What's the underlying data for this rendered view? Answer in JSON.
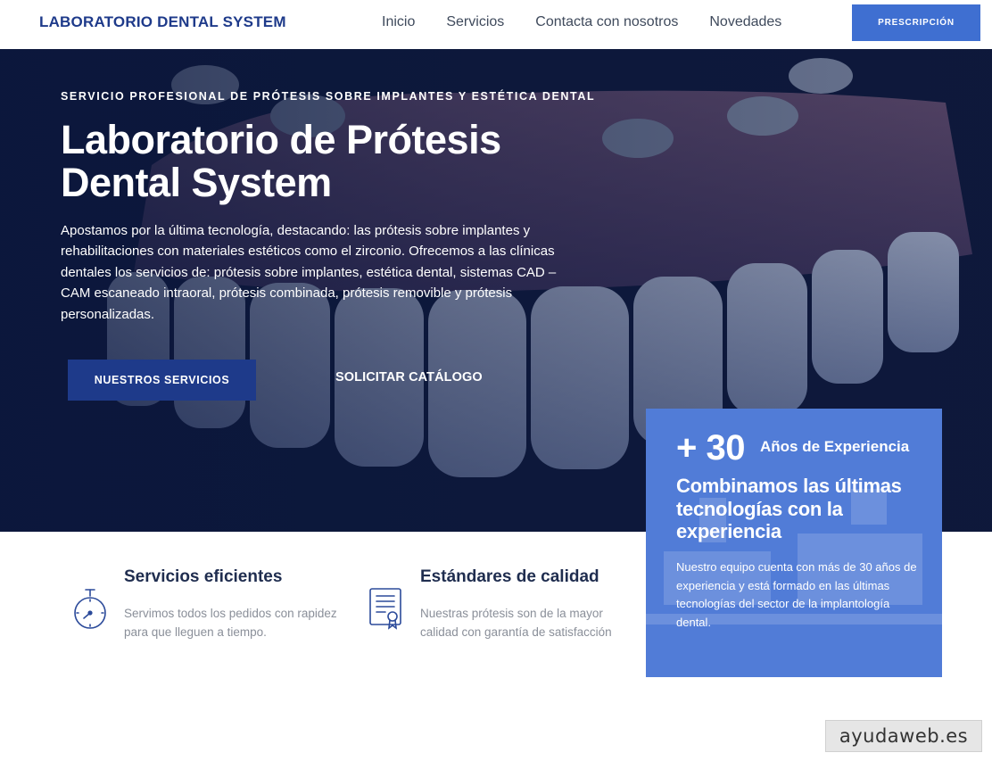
{
  "header": {
    "brand": "LABORATORIO DENTAL SYSTEM",
    "nav": [
      "Inicio",
      "Servicios",
      "Contacta con nosotros",
      "Novedades"
    ],
    "cta": "PRESCRIPCIÓN"
  },
  "hero": {
    "eyebrow": "SERVICIO PROFESIONAL DE PRÓTESIS SOBRE IMPLANTES Y ESTÉTICA DENTAL",
    "title": "Laboratorio de Prótesis Dental System",
    "text": "Apostamos por la última tecnología, destacando: las prótesis sobre implantes y rehabilitaciones con materiales estéticos como el zirconio. Ofrecemos a las clínicas dentales los servicios de: prótesis sobre implantes, estética dental, sistemas CAD – CAM escaneado intraoral, prótesis combinada, prótesis removible y prótesis personalizadas.",
    "primary_button": "NUESTROS SERVICIOS",
    "secondary_button": "SOLICITAR CATÁLOGO"
  },
  "experience": {
    "number": "+ 30",
    "years_label": "Años de Experiencia",
    "title": "Combinamos las últimas tecnologías con la experiencia",
    "text": "Nuestro equipo cuenta con más de 30 años de experiencia y está formado en las últimas tecnologías del sector de la implantología dental."
  },
  "features": [
    {
      "icon": "stopwatch-icon",
      "title": "Servicios eficientes",
      "text": "Servimos todos los pedidos con rapidez para que lleguen a tiempo."
    },
    {
      "icon": "certificate-icon",
      "title": "Estándares de calidad",
      "text": "Nuestras prótesis son de la mayor calidad con garantía de satisfacción"
    }
  ],
  "watermark": "ayudaweb.es",
  "colors": {
    "brand_blue": "#1e3a8a",
    "accent_blue": "#3f6fd1",
    "card_blue": "#4b78d6",
    "hero_dark": "#0d1735"
  }
}
